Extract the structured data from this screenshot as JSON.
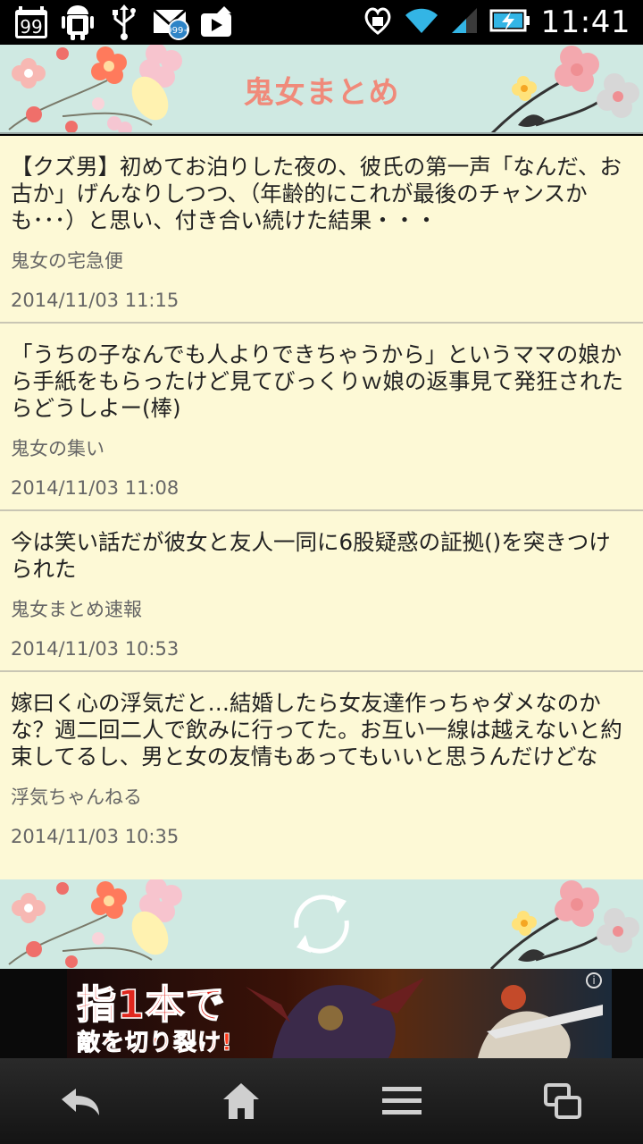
{
  "status_bar": {
    "time": "11:41",
    "notification_badge": "99",
    "mail_badge": "999+",
    "icons": [
      "calendar-badge-icon",
      "android-icon",
      "usb-icon",
      "mail-icon",
      "video-upload-icon",
      "heart-lock-icon",
      "wifi-icon",
      "signal-icon",
      "battery-charging-icon"
    ]
  },
  "header": {
    "title": "鬼女まとめ"
  },
  "articles": [
    {
      "title": "【クズ男】初めてお泊りした夜の、彼氏の第一声「なんだ、お古か」げんなりしつつ、（年齢的にこれが最後のチャンスかも･･･）と思い、付き合い続けた結果・・・",
      "source": "鬼女の宅急便",
      "date": "2014/11/03 11:15"
    },
    {
      "title": "「うちの子なんでも人よりできちゃうから」というママの娘から手紙をもらったけど見てびっくりｗ娘の返事見て発狂されたらどうしよー(棒)",
      "source": "鬼女の集い",
      "date": "2014/11/03 11:08"
    },
    {
      "title": "今は笑い話だが彼女と友人一同に6股疑惑の証拠()を突きつけられた",
      "source": "鬼女まとめ速報",
      "date": "2014/11/03 10:53"
    },
    {
      "title": "嫁曰く心の浮気だと…結婚したら女友達作っちゃダメなのかな？週二回二人で飲みに行ってた。お互い一線は越えないと約束してるし、男と女の友情もあってもいいと思うんだけどな",
      "source": "浮気ちゃんねる",
      "date": "2014/11/03 10:35"
    }
  ],
  "refresh": {
    "icon": "refresh-icon"
  },
  "ad": {
    "line1": "指1本で",
    "line2": "敵を切り裂け!",
    "info_icon": "i"
  },
  "navbar": {
    "items": [
      "back-icon",
      "home-icon",
      "menu-icon",
      "recent-apps-icon"
    ]
  },
  "colors": {
    "header_bg": "#cfe9e2",
    "title": "#f08a7a",
    "feed_bg": "#fdf9d6"
  }
}
